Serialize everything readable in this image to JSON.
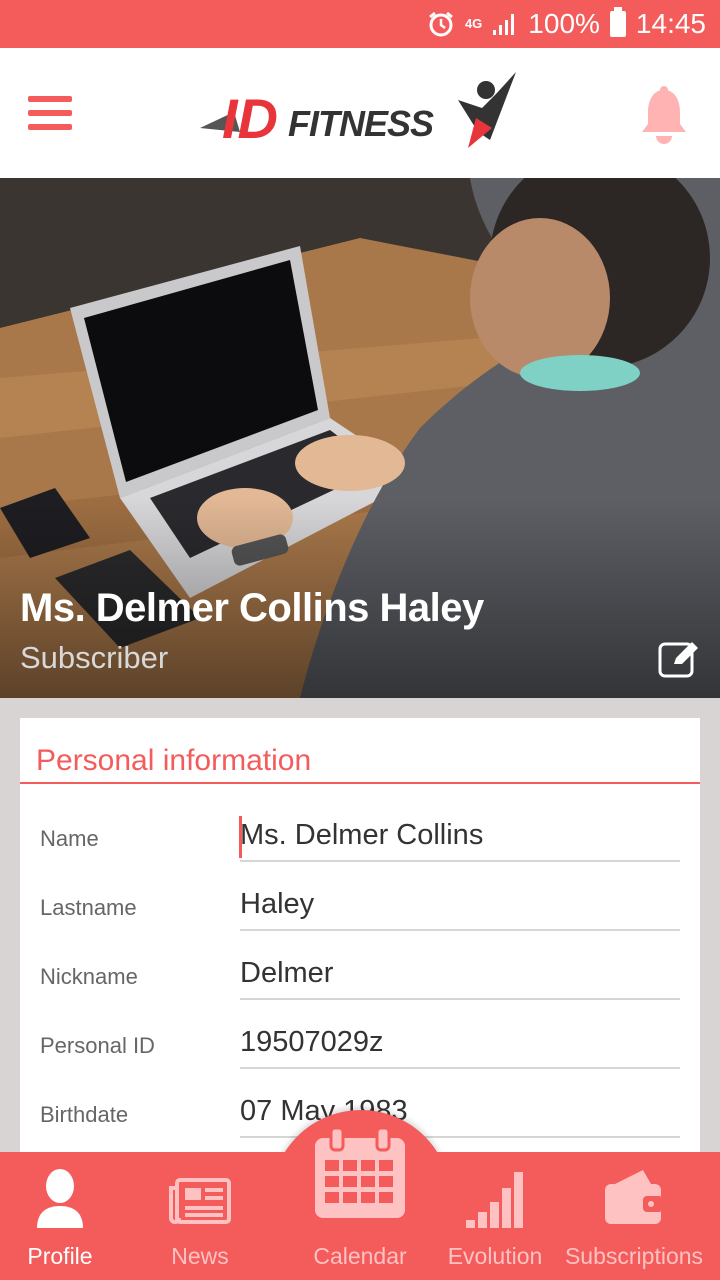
{
  "status_bar": {
    "network": "4G",
    "battery": "100%",
    "time": "14:45"
  },
  "app_bar": {
    "logo_text_id": "ID",
    "logo_text_fitness": "FITNESS"
  },
  "profile": {
    "full_name": "Ms. Delmer Collins Haley",
    "role": "Subscriber"
  },
  "personal_info": {
    "title": "Personal information",
    "fields": [
      {
        "label": "Name",
        "value": "Ms. Delmer Collins"
      },
      {
        "label": "Lastname",
        "value": "Haley"
      },
      {
        "label": "Nickname",
        "value": "Delmer"
      },
      {
        "label": "Personal ID",
        "value": "19507029z"
      },
      {
        "label": "Birthdate",
        "value": "07 May 1983"
      }
    ]
  },
  "bottom_nav": {
    "items": [
      {
        "label": "Profile",
        "icon": "person-icon",
        "active": true
      },
      {
        "label": "News",
        "icon": "newspaper-icon",
        "active": false
      },
      {
        "label": "Calendar",
        "icon": "calendar-icon",
        "active": false
      },
      {
        "label": "Evolution",
        "icon": "signal-bars-icon",
        "active": false
      },
      {
        "label": "Subscriptions",
        "icon": "wallet-icon",
        "active": false
      }
    ]
  },
  "colors": {
    "accent": "#f45b5b",
    "inactive_nav": "#ffc2c2",
    "card_background": "#ffffff",
    "page_background": "#d9d4d4"
  }
}
